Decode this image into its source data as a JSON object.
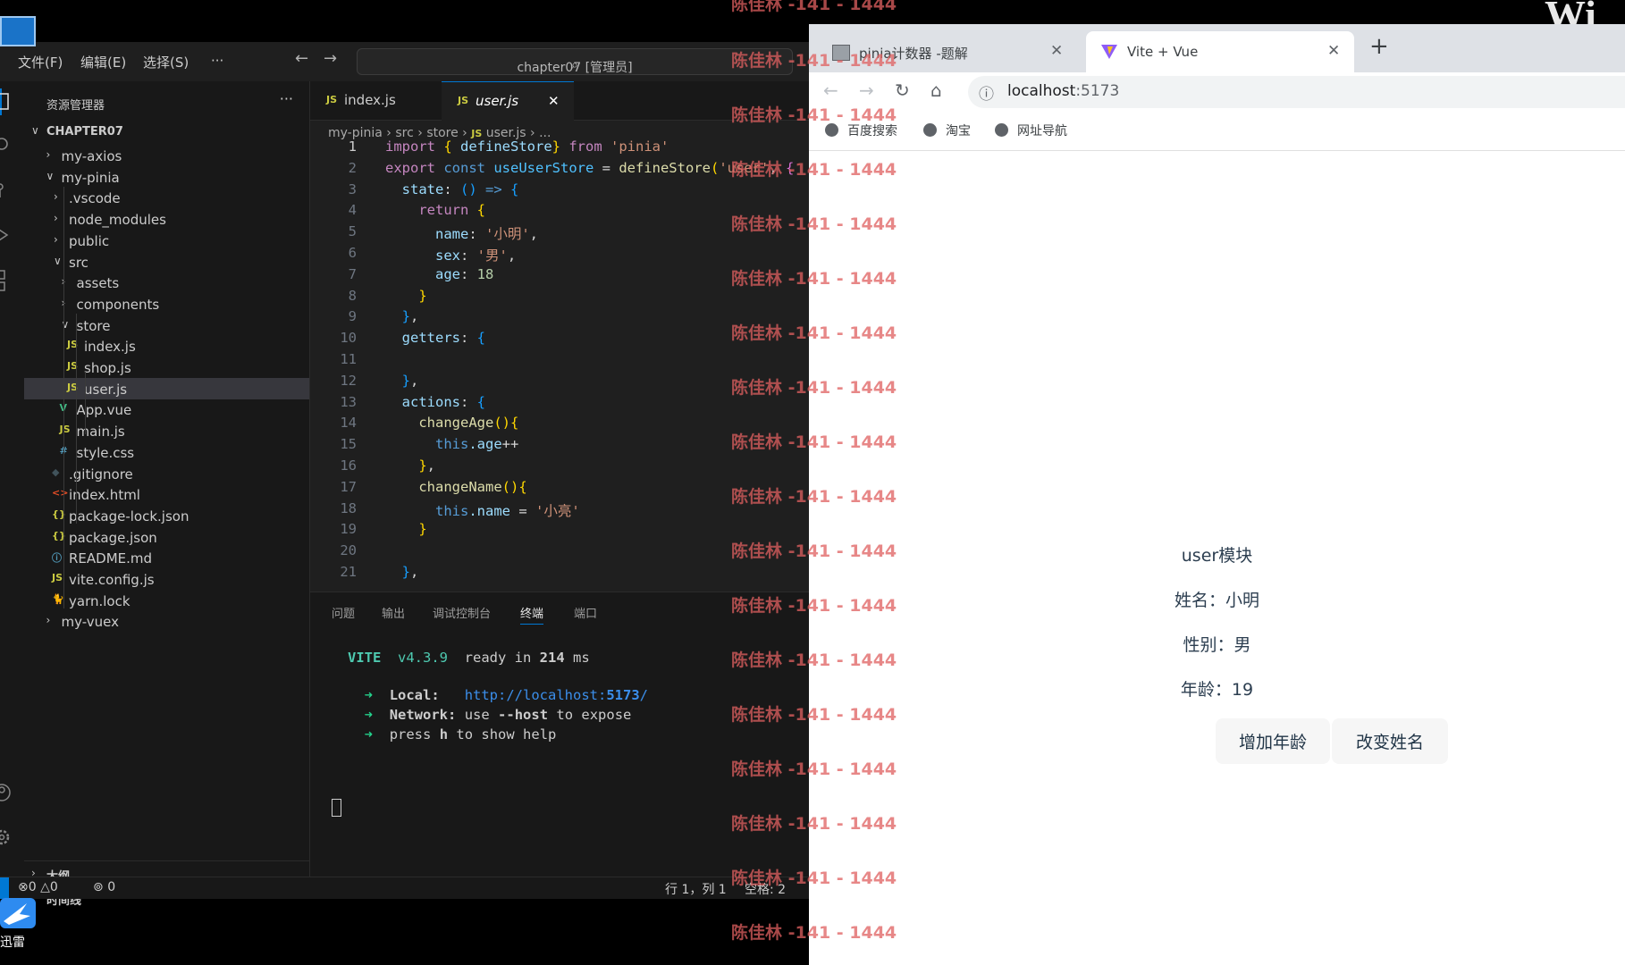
{
  "vscode": {
    "menu": [
      "文件(F)",
      "编辑(E)",
      "选择(S)",
      "···"
    ],
    "command_center": "chapter07 [管理员]",
    "explorer_title": "资源管理器",
    "root_folder": "CHAPTER07",
    "tree": [
      {
        "label": "my-axios",
        "kind": "folder",
        "open": false,
        "depth": 1
      },
      {
        "label": "my-pinia",
        "kind": "folder",
        "open": true,
        "depth": 1
      },
      {
        "label": ".vscode",
        "kind": "folder",
        "open": false,
        "depth": 2
      },
      {
        "label": "node_modules",
        "kind": "folder",
        "open": false,
        "depth": 2
      },
      {
        "label": "public",
        "kind": "folder",
        "open": false,
        "depth": 2
      },
      {
        "label": "src",
        "kind": "folder",
        "open": true,
        "depth": 2
      },
      {
        "label": "assets",
        "kind": "folder",
        "open": false,
        "depth": 3
      },
      {
        "label": "components",
        "kind": "folder",
        "open": false,
        "depth": 3
      },
      {
        "label": "store",
        "kind": "folder",
        "open": true,
        "depth": 3
      },
      {
        "label": "index.js",
        "kind": "js",
        "depth": 4
      },
      {
        "label": "shop.js",
        "kind": "js",
        "depth": 4
      },
      {
        "label": "user.js",
        "kind": "js",
        "depth": 4,
        "active": true
      },
      {
        "label": "App.vue",
        "kind": "vue",
        "depth": 3
      },
      {
        "label": "main.js",
        "kind": "js",
        "depth": 3
      },
      {
        "label": "style.css",
        "kind": "css",
        "depth": 3
      },
      {
        "label": ".gitignore",
        "kind": "git",
        "depth": 2
      },
      {
        "label": "index.html",
        "kind": "html",
        "depth": 2
      },
      {
        "label": "package-lock.json",
        "kind": "json",
        "depth": 2
      },
      {
        "label": "package.json",
        "kind": "json",
        "depth": 2
      },
      {
        "label": "README.md",
        "kind": "info",
        "depth": 2
      },
      {
        "label": "vite.config.js",
        "kind": "js",
        "depth": 2
      },
      {
        "label": "yarn.lock",
        "kind": "yarn",
        "depth": 2
      },
      {
        "label": "my-vuex",
        "kind": "folder",
        "open": false,
        "depth": 1
      }
    ],
    "outline_label": "大纲",
    "timeline_label": "时间线",
    "tabs": [
      {
        "label": "index.js",
        "active": false
      },
      {
        "label": "user.js",
        "active": true
      }
    ],
    "breadcrumbs": [
      "my-pinia",
      "src",
      "store",
      "user.js",
      "..."
    ],
    "code_lines": [
      [
        [
          "import ",
          "#c586c0"
        ],
        [
          "{ ",
          "#ffd700"
        ],
        [
          "defineStore",
          "#9cdcfe"
        ],
        [
          "} ",
          "#ffd700"
        ],
        [
          "from ",
          "#c586c0"
        ],
        [
          "'pinia'",
          "#ce9178"
        ]
      ],
      [
        [
          "export ",
          "#c586c0"
        ],
        [
          "const ",
          "#569cd6"
        ],
        [
          "useUserStore",
          "#4fc1ff"
        ],
        [
          " = ",
          "#d4d4d4"
        ],
        [
          "defineStore",
          "#dcdcaa"
        ],
        [
          "(",
          "#ffd700"
        ],
        [
          "'user'",
          "#ce9178"
        ],
        [
          ", ",
          "#d4d4d4"
        ],
        [
          "{",
          "#da70d6"
        ]
      ],
      [
        [
          "  state",
          "#9cdcfe"
        ],
        [
          ": ",
          "#d4d4d4"
        ],
        [
          "() ",
          "#179fff"
        ],
        [
          "=> ",
          "#569cd6"
        ],
        [
          "{",
          "#179fff"
        ]
      ],
      [
        [
          "    return ",
          "#c586c0"
        ],
        [
          "{",
          "#ffd700"
        ]
      ],
      [
        [
          "      name",
          "#9cdcfe"
        ],
        [
          ": ",
          "#d4d4d4"
        ],
        [
          "'小明'",
          "#ce9178"
        ],
        [
          ",",
          "#d4d4d4"
        ]
      ],
      [
        [
          "      sex",
          "#9cdcfe"
        ],
        [
          ": ",
          "#d4d4d4"
        ],
        [
          "'男'",
          "#ce9178"
        ],
        [
          ",",
          "#d4d4d4"
        ]
      ],
      [
        [
          "      age",
          "#9cdcfe"
        ],
        [
          ": ",
          "#d4d4d4"
        ],
        [
          "18",
          "#b5cea8"
        ]
      ],
      [
        [
          "    }",
          "#ffd700"
        ]
      ],
      [
        [
          "  }",
          "#179fff"
        ],
        [
          ",",
          "#d4d4d4"
        ]
      ],
      [
        [
          "  getters",
          "#9cdcfe"
        ],
        [
          ": ",
          "#d4d4d4"
        ],
        [
          "{",
          "#179fff"
        ]
      ],
      [],
      [
        [
          "  }",
          "#179fff"
        ],
        [
          ",",
          "#d4d4d4"
        ]
      ],
      [
        [
          "  actions",
          "#9cdcfe"
        ],
        [
          ": ",
          "#d4d4d4"
        ],
        [
          "{",
          "#179fff"
        ]
      ],
      [
        [
          "    changeAge",
          "#dcdcaa"
        ],
        [
          "(){",
          "#ffd700"
        ]
      ],
      [
        [
          "      this",
          "#569cd6"
        ],
        [
          ".age",
          "#9cdcfe"
        ],
        [
          "++",
          "#d4d4d4"
        ]
      ],
      [
        [
          "    }",
          "#ffd700"
        ],
        [
          ",",
          "#d4d4d4"
        ]
      ],
      [
        [
          "    changeName",
          "#dcdcaa"
        ],
        [
          "(){",
          "#ffd700"
        ]
      ],
      [
        [
          "      this",
          "#569cd6"
        ],
        [
          ".name",
          "#9cdcfe"
        ],
        [
          " = ",
          "#d4d4d4"
        ],
        [
          "'小亮'",
          "#ce9178"
        ]
      ],
      [
        [
          "    }",
          "#ffd700"
        ]
      ],
      [],
      [
        [
          "  }",
          "#179fff"
        ],
        [
          ",",
          "#d4d4d4"
        ]
      ]
    ],
    "panel_tabs": [
      "问题",
      "输出",
      "调试控制台",
      "终端",
      "端口"
    ],
    "panel_active": 3,
    "terminal": {
      "vite": "VITE",
      "version": "v4.3.9",
      "ready": "ready in",
      "ms_value": "214",
      "ms": "ms",
      "arrow": "➜",
      "local_label": "Local:",
      "local_url": "http://localhost:",
      "local_port": "5173",
      "local_slash": "/",
      "network_label": "Network:",
      "network_text_a": "use",
      "network_flag": "--host",
      "network_text_b": "to expose",
      "help_a": "press",
      "help_key": "h",
      "help_b": "to show help"
    },
    "status": {
      "errors": "0",
      "warnings": "0",
      "ports": "0",
      "position": "行 1，列 1",
      "spaces": "空格: 2"
    }
  },
  "browser": {
    "tabs": [
      {
        "title": "pinia计数器 -题解",
        "active": false
      },
      {
        "title": "Vite + Vue",
        "active": true
      }
    ],
    "new_tab": "+",
    "url_host": "localhost",
    "url_port": ":5173",
    "bookmarks": [
      "百度搜索",
      "淘宝",
      "网址导航"
    ]
  },
  "app": {
    "module_title": "user模块",
    "name_line": "姓名：小明",
    "sex_line": "性别：男",
    "age_line": "年龄：19",
    "btn_add_age": "增加年龄",
    "btn_change_name": "改变姓名"
  },
  "desktop": {
    "thunder_label": "迅雷",
    "corner_text": "Wi"
  },
  "watermark": "陈佳林 -141 - 1444",
  "colors": {
    "vscode_bg": "#1e1e1e",
    "accent_blue": "#0078d4",
    "vite_green": "#4ec9b0",
    "watermark": "#e06060"
  }
}
